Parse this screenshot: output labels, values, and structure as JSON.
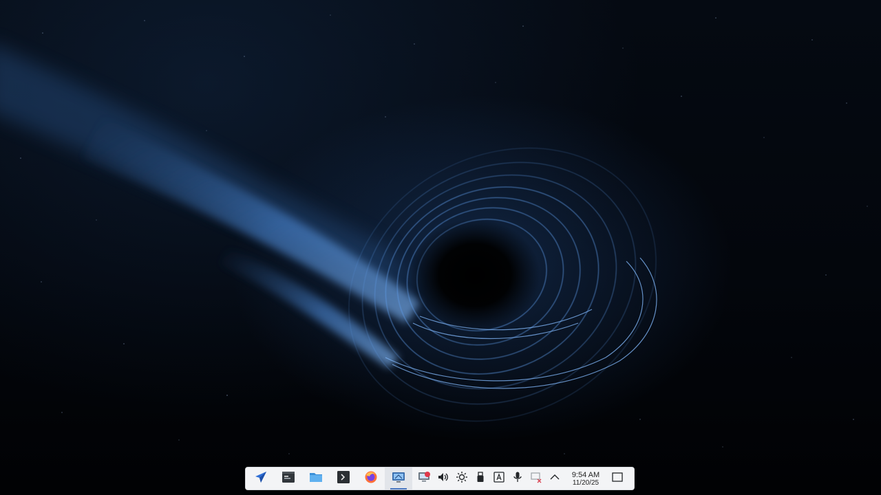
{
  "taskbar": {
    "apps": [
      {
        "name": "Application Launcher"
      },
      {
        "name": "Terminal Window"
      },
      {
        "name": "Files"
      },
      {
        "name": "Konsole"
      },
      {
        "name": "Firefox"
      },
      {
        "name": "Desktop Viewer"
      }
    ],
    "tray": {
      "clock_time": "9:54 AM",
      "clock_date": "11/20/25"
    }
  },
  "colors": {
    "accent": "#4a78c2",
    "wallpaper_glow": "#4f8fe0"
  }
}
